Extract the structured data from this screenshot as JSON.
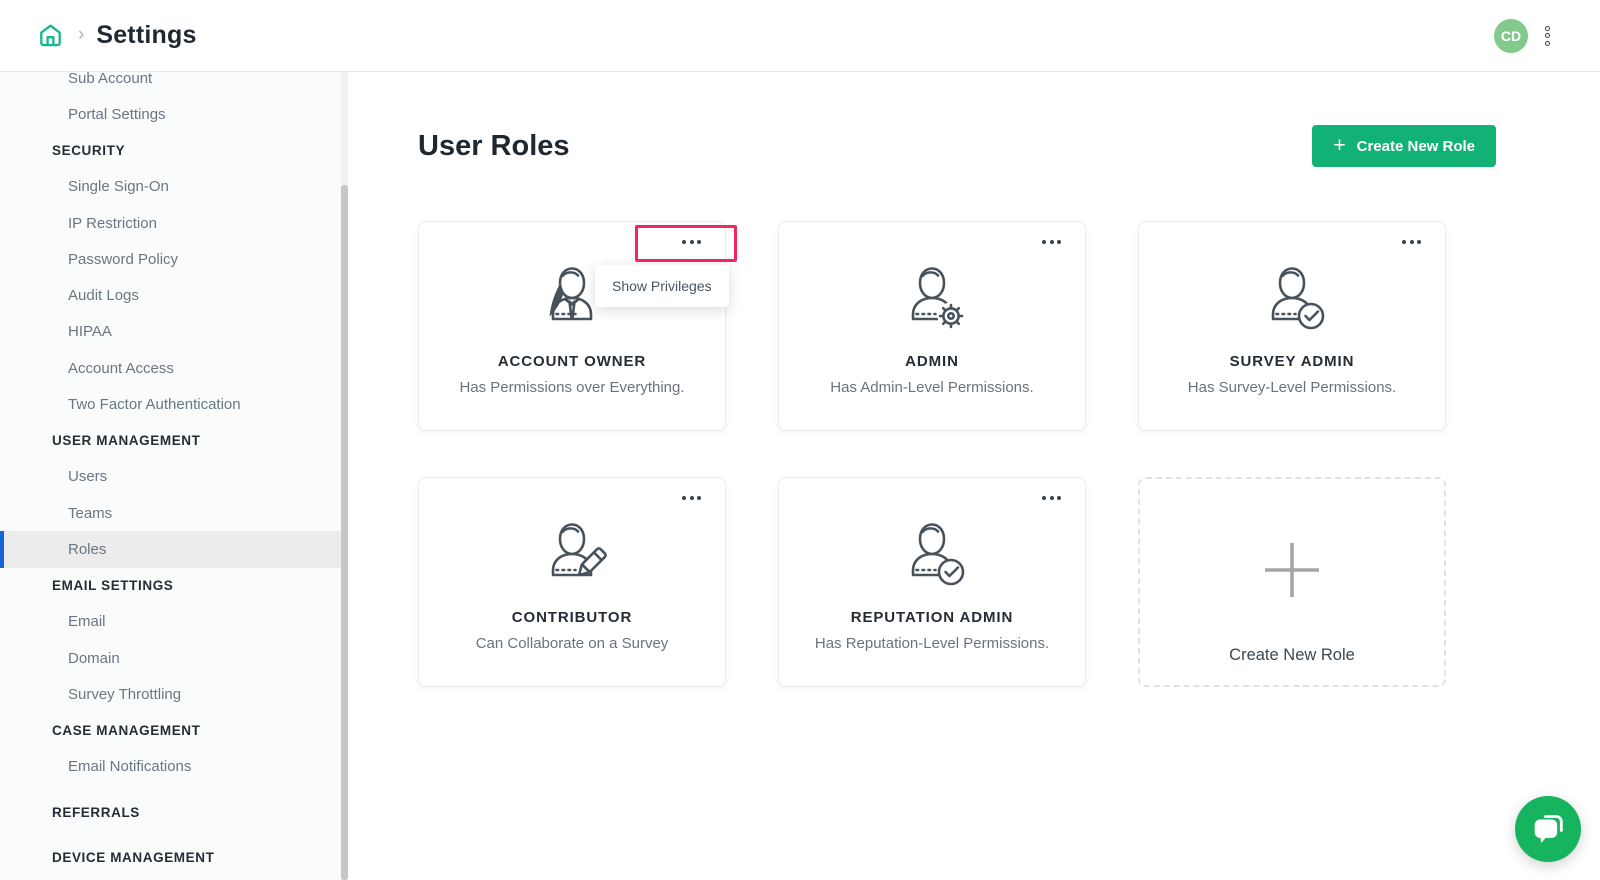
{
  "colors": {
    "accent_green": "#12b176",
    "home_green": "#14b78f",
    "avatar_green": "#82ca8c",
    "chat_green": "#16b45f",
    "selected_blue": "#1664d8",
    "highlight_red": "#f2275e"
  },
  "header": {
    "title": "Settings",
    "home_icon": "home-icon",
    "menu_icon": "kebab-menu-icon",
    "avatar_initials": "CD"
  },
  "sidebar": {
    "items": [
      {
        "type": "link",
        "label": "Sub Account"
      },
      {
        "type": "link",
        "label": "Portal Settings"
      },
      {
        "type": "section",
        "label": "SECURITY"
      },
      {
        "type": "link",
        "label": "Single Sign-On"
      },
      {
        "type": "link",
        "label": "IP Restriction"
      },
      {
        "type": "link",
        "label": "Password Policy"
      },
      {
        "type": "link",
        "label": "Audit Logs"
      },
      {
        "type": "link",
        "label": "HIPAA"
      },
      {
        "type": "link",
        "label": "Account Access"
      },
      {
        "type": "link",
        "label": "Two Factor Authentication"
      },
      {
        "type": "section",
        "label": "USER MANAGEMENT"
      },
      {
        "type": "link",
        "label": "Users"
      },
      {
        "type": "link",
        "label": "Teams"
      },
      {
        "type": "link",
        "label": "Roles",
        "selected": true
      },
      {
        "type": "section",
        "label": "EMAIL SETTINGS"
      },
      {
        "type": "link",
        "label": "Email"
      },
      {
        "type": "link",
        "label": "Domain"
      },
      {
        "type": "link",
        "label": "Survey Throttling"
      },
      {
        "type": "section",
        "label": "CASE MANAGEMENT"
      },
      {
        "type": "link",
        "label": "Email Notifications"
      },
      {
        "type": "section",
        "label": "REFERRALS"
      },
      {
        "type": "section",
        "label": "DEVICE MANAGEMENT"
      }
    ]
  },
  "main": {
    "title": "User Roles",
    "create_button_label": "Create New Role",
    "create_button_icon": "plus-icon",
    "roles": [
      {
        "name": "ACCOUNT OWNER",
        "description": "Has Permissions over Everything.",
        "icon": "account-owner-icon",
        "menu_icon": "ellipsis-icon",
        "menu_highlighted": true,
        "tooltip": "Show Privileges"
      },
      {
        "name": "ADMIN",
        "description": "Has Admin-Level Permissions.",
        "icon": "admin-icon",
        "menu_icon": "ellipsis-icon"
      },
      {
        "name": "SURVEY ADMIN",
        "description": "Has Survey-Level Permissions.",
        "icon": "survey-admin-icon",
        "menu_icon": "ellipsis-icon"
      },
      {
        "name": "CONTRIBUTOR",
        "description": "Can Collaborate on a Survey",
        "icon": "contributor-icon",
        "menu_icon": "ellipsis-icon"
      },
      {
        "name": "REPUTATION ADMIN",
        "description": "Has Reputation-Level Permissions.",
        "icon": "reputation-admin-icon",
        "menu_icon": "ellipsis-icon"
      },
      {
        "type": "create",
        "name": "Create New Role",
        "icon": "plus-icon"
      }
    ]
  },
  "chat": {
    "icon": "chat-bubbles-icon"
  }
}
